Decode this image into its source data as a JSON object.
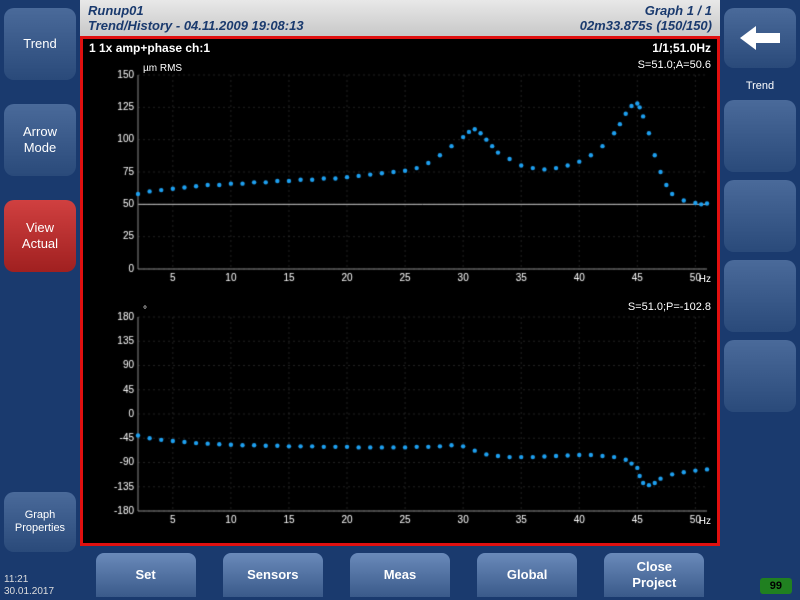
{
  "header": {
    "title": "Runup01",
    "subtitle": "Trend/History - 04.11.2009 19:08:13",
    "graph_pos": "Graph 1 / 1",
    "time": "02m33.875s (150/150)"
  },
  "left_buttons": [
    {
      "label": "Trend",
      "active": false
    },
    {
      "label": "Arrow\nMode",
      "active": false
    },
    {
      "label": "View\nActual",
      "active": true
    },
    {
      "label": "Graph\nProperties",
      "active": false
    }
  ],
  "right_label": "Trend",
  "bottom_buttons": [
    "Set",
    "Sensors",
    "Meas",
    "Global",
    "Close\nProject"
  ],
  "status": {
    "time": "11:21",
    "date": "30.01.2017"
  },
  "badge": "99",
  "chart_header": {
    "left": "1 1x amp+phase ch:1",
    "right": "1/1;51.0Hz"
  },
  "chart_data": [
    {
      "type": "scatter",
      "title": "",
      "ylabel": "µm RMS",
      "xlabel": "Hz",
      "annotation": "S=51.0;A=50.6",
      "xlim": [
        2,
        51
      ],
      "ylim": [
        0,
        150
      ],
      "xticks": [
        5,
        10,
        15,
        20,
        25,
        30,
        35,
        40,
        45,
        50
      ],
      "yticks": [
        0,
        25,
        50,
        75,
        100,
        125,
        150
      ],
      "horizontal_line": 50,
      "x": [
        2,
        3,
        4,
        5,
        6,
        7,
        8,
        9,
        10,
        11,
        12,
        13,
        14,
        15,
        16,
        17,
        18,
        19,
        20,
        21,
        22,
        23,
        24,
        25,
        26,
        27,
        28,
        29,
        30,
        30.5,
        31,
        31.5,
        32,
        32.5,
        33,
        34,
        35,
        36,
        37,
        38,
        39,
        40,
        41,
        42,
        43,
        43.5,
        44,
        44.5,
        45,
        45.2,
        45.5,
        46,
        46.5,
        47,
        47.5,
        48,
        49,
        50,
        50.5,
        51
      ],
      "y": [
        58,
        60,
        61,
        62,
        63,
        64,
        65,
        65,
        66,
        66,
        67,
        67,
        68,
        68,
        69,
        69,
        70,
        70,
        71,
        72,
        73,
        74,
        75,
        76,
        78,
        82,
        88,
        95,
        102,
        106,
        108,
        105,
        100,
        95,
        90,
        85,
        80,
        78,
        77,
        78,
        80,
        83,
        88,
        95,
        105,
        112,
        120,
        126,
        128,
        125,
        118,
        105,
        88,
        75,
        65,
        58,
        53,
        51,
        50,
        50.6
      ]
    },
    {
      "type": "scatter",
      "title": "",
      "ylabel": "°",
      "xlabel": "Hz",
      "annotation": "S=51.0;P=-102.8",
      "xlim": [
        2,
        51
      ],
      "ylim": [
        -180,
        180
      ],
      "xticks": [
        5,
        10,
        15,
        20,
        25,
        30,
        35,
        40,
        45,
        50
      ],
      "yticks": [
        -180,
        -135,
        -90,
        -45,
        0,
        45,
        90,
        135,
        180
      ],
      "x": [
        2,
        3,
        4,
        5,
        6,
        7,
        8,
        9,
        10,
        11,
        12,
        13,
        14,
        15,
        16,
        17,
        18,
        19,
        20,
        21,
        22,
        23,
        24,
        25,
        26,
        27,
        28,
        29,
        30,
        31,
        32,
        33,
        34,
        35,
        36,
        37,
        38,
        39,
        40,
        41,
        42,
        43,
        44,
        44.5,
        45,
        45.2,
        45.5,
        46,
        46.5,
        47,
        48,
        49,
        50,
        51
      ],
      "y": [
        -40,
        -45,
        -48,
        -50,
        -52,
        -54,
        -55,
        -56,
        -57,
        -58,
        -58,
        -59,
        -59,
        -60,
        -60,
        -60,
        -61,
        -61,
        -61,
        -62,
        -62,
        -62,
        -62,
        -62,
        -61,
        -61,
        -60,
        -58,
        -60,
        -68,
        -75,
        -78,
        -80,
        -80,
        -80,
        -79,
        -78,
        -77,
        -76,
        -76,
        -78,
        -80,
        -85,
        -92,
        -100,
        -115,
        -128,
        -132,
        -128,
        -120,
        -112,
        -108,
        -105,
        -102.8
      ]
    }
  ]
}
